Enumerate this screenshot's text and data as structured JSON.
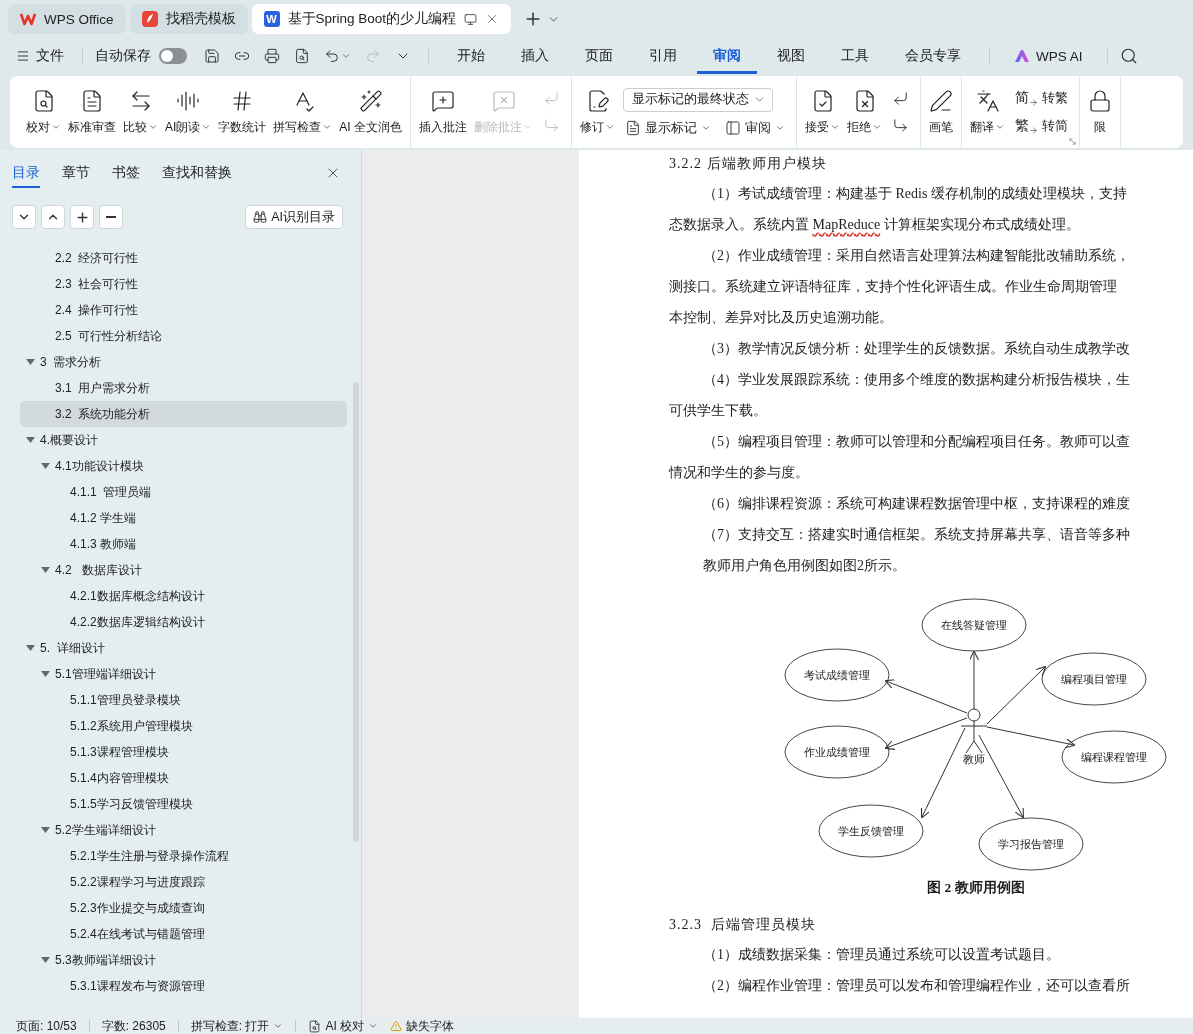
{
  "title_tabs": [
    {
      "kind": "home",
      "label": "WPS Office",
      "selected": false
    },
    {
      "kind": "template",
      "label": "找稻壳模板",
      "selected": false
    },
    {
      "kind": "document",
      "logo_letter": "W",
      "label": "基于Spring Boot的少儿编程",
      "selected": true
    }
  ],
  "menu_bar": {
    "file": "文件",
    "autosave": {
      "label": "自动保存",
      "on": false
    },
    "quick_tools": [
      {
        "dropdown": false,
        "disabled": false
      },
      {
        "dropdown": false,
        "disabled": false
      },
      {
        "dropdown": false,
        "disabled": false
      },
      {
        "dropdown": false,
        "disabled": false
      },
      {
        "dropdown": true,
        "disabled": false
      },
      {
        "dropdown": false,
        "disabled": true
      },
      {
        "dropdown": false,
        "disabled": false
      }
    ],
    "tabs": [
      {
        "label": "开始",
        "selected": false
      },
      {
        "label": "插入",
        "selected": false
      },
      {
        "label": "页面",
        "selected": false
      },
      {
        "label": "引用",
        "selected": false
      },
      {
        "label": "审阅",
        "selected": true
      },
      {
        "label": "视图",
        "selected": false
      },
      {
        "label": "工具",
        "selected": false
      },
      {
        "label": "会员专享",
        "selected": false
      }
    ],
    "ai": "WPS AI"
  },
  "ribbon": {
    "groups": [
      {
        "launcher": false,
        "items": [
          {
            "kind": "large",
            "label": "校对",
            "dropdown": true,
            "disabled": false
          },
          {
            "kind": "large",
            "label": "标准审查",
            "dropdown": false,
            "disabled": false
          },
          {
            "kind": "large",
            "label": "比较",
            "dropdown": true,
            "disabled": false
          },
          {
            "kind": "large",
            "label": "AI朗读",
            "dropdown": true,
            "disabled": false
          },
          {
            "kind": "large",
            "label": "字数统计",
            "dropdown": false,
            "disabled": false
          },
          {
            "kind": "large",
            "label": "拼写检查",
            "dropdown": true,
            "disabled": false
          },
          {
            "kind": "large",
            "label": "AI 全文润色",
            "dropdown": false,
            "disabled": false
          }
        ]
      },
      {
        "launcher": false,
        "items": [
          {
            "kind": "large",
            "label": "插入批注",
            "dropdown": false,
            "disabled": false
          },
          {
            "kind": "large",
            "label": "删除批注",
            "dropdown": true,
            "disabled": true
          },
          {
            "kind": "stack",
            "buttons": [
              {
                "disabled": true
              },
              {
                "disabled": true
              }
            ]
          }
        ]
      },
      {
        "launcher": false,
        "items": [
          {
            "kind": "large",
            "label": "修订",
            "dropdown": true,
            "disabled": false
          },
          {
            "kind": "panel",
            "select": "显示标记的最终状态",
            "buttons": [
              {
                "label": "显示标记",
                "dropdown": true
              },
              {
                "label": "审阅",
                "dropdown": true
              }
            ]
          }
        ]
      },
      {
        "launcher": false,
        "items": [
          {
            "kind": "large",
            "label": "接受",
            "dropdown": true,
            "disabled": false
          },
          {
            "kind": "large",
            "label": "拒绝",
            "dropdown": true,
            "disabled": false
          },
          {
            "kind": "stack",
            "buttons": [
              {
                "disabled": false
              },
              {
                "disabled": false
              }
            ]
          }
        ]
      },
      {
        "launcher": false,
        "items": [
          {
            "kind": "large",
            "label": "画笔",
            "dropdown": false,
            "disabled": false
          }
        ]
      },
      {
        "launcher": true,
        "items": [
          {
            "kind": "large",
            "label": "翻译",
            "dropdown": true,
            "disabled": false
          },
          {
            "kind": "stack",
            "buttons": [
              {
                "glyph": "简",
                "label": "转繁",
                "disabled": false
              },
              {
                "glyph": "繁",
                "label": "转简",
                "disabled": false
              }
            ]
          }
        ]
      },
      {
        "launcher": false,
        "items": [
          {
            "kind": "large",
            "label": "限",
            "dropdown": false,
            "disabled": false
          }
        ]
      }
    ]
  },
  "sidebar": {
    "tabs": [
      {
        "label": "目录",
        "selected": true
      },
      {
        "label": "章节",
        "selected": false
      },
      {
        "label": "书签",
        "selected": false
      },
      {
        "label": "查找和替换",
        "selected": false
      }
    ],
    "tool_button": "AI识别目录",
    "outline": [
      {
        "children": [
          {
            "label": "2.2  经济可行性",
            "selected": false
          },
          {
            "label": "2.3  社会可行性",
            "selected": false
          },
          {
            "label": "2.4  操作可行性",
            "selected": false
          },
          {
            "label": "2.5  可行性分析结论",
            "selected": false
          }
        ]
      },
      {
        "label": "3  需求分析",
        "selected": false,
        "expanded": true,
        "children": [
          {
            "label": "3.1  用户需求分析",
            "selected": false
          },
          {
            "label": "3.2  系统功能分析",
            "selected": true
          }
        ]
      },
      {
        "label": "4.概要设计",
        "selected": false,
        "expanded": true,
        "children": [
          {
            "label": "4.1功能设计模块",
            "selected": false,
            "expanded": true,
            "children": [
              {
                "label": "4.1.1  管理员端",
                "selected": false
              },
              {
                "label": "4.1.2 学生端",
                "selected": false
              },
              {
                "label": "4.1.3 教师端",
                "selected": false
              }
            ]
          },
          {
            "label": "4.2   数据库设计",
            "selected": false,
            "expanded": true,
            "children": [
              {
                "label": "4.2.1数据库概念结构设计",
                "selected": false
              },
              {
                "label": "4.2.2数据库逻辑结构设计",
                "selected": false
              }
            ]
          }
        ]
      },
      {
        "label": "5.  详细设计",
        "selected": false,
        "expanded": true,
        "children": [
          {
            "label": "5.1管理端详细设计",
            "selected": false,
            "expanded": true,
            "children": [
              {
                "label": "5.1.1管理员登录模块",
                "selected": false
              },
              {
                "label": "5.1.2系统用户管理模块",
                "selected": false
              },
              {
                "label": "5.1.3课程管理模块",
                "selected": false
              },
              {
                "label": "5.1.4内容管理模块",
                "selected": false
              },
              {
                "label": "5.1.5学习反馈管理模块",
                "selected": false
              }
            ]
          },
          {
            "label": "5.2学生端详细设计",
            "selected": false,
            "expanded": true,
            "children": [
              {
                "label": "5.2.1学生注册与登录操作流程",
                "selected": false
              },
              {
                "label": "5.2.2课程学习与进度跟踪",
                "selected": false
              },
              {
                "label": "5.2.3作业提交与成绩查询",
                "selected": false
              },
              {
                "label": "5.2.4在线考试与错题管理",
                "selected": false
              }
            ]
          },
          {
            "label": "5.3教师端详细设计",
            "selected": false,
            "expanded": true,
            "children": [
              {
                "label": "5.3.1课程发布与资源管理",
                "selected": false
              }
            ]
          }
        ]
      }
    ]
  },
  "document": {
    "blocks": [
      {
        "kind": "heading",
        "text": "3.2.2 后端教师用户模块"
      },
      {
        "kind": "line",
        "indent": true,
        "text": "（1）考试成绩管理：构建基于 Redis 缓存机制的成绩处理模块，支持"
      },
      {
        "kind": "line",
        "indent": false,
        "segments": [
          {
            "text": "态数据录入。系统内置 ",
            "misspelled": false
          },
          {
            "text": "MapReduce",
            "misspelled": true
          },
          {
            "text": " 计算框架实现分布式成绩处理。",
            "misspelled": false
          }
        ]
      },
      {
        "kind": "line",
        "indent": true,
        "text": "（2）作业成绩管理：采用自然语言处理算法构建智能批改辅助系统，"
      },
      {
        "kind": "line",
        "indent": false,
        "text": "测接口。系统建立评语特征库，支持个性化评语生成。作业生命周期管理"
      },
      {
        "kind": "line",
        "indent": false,
        "text": "本控制、差异对比及历史追溯功能。"
      },
      {
        "kind": "line",
        "indent": true,
        "text": "（3）教学情况反馈分析：处理学生的反馈数据。系统自动生成教学改"
      },
      {
        "kind": "line",
        "indent": true,
        "text": "（4）学业发展跟踪系统：使用多个维度的数据构建分析报告模块，生"
      },
      {
        "kind": "line",
        "indent": false,
        "text": "可供学生下载。"
      },
      {
        "kind": "line",
        "indent": true,
        "text": "（5）编程项目管理：教师可以管理和分配编程项目任务。教师可以查"
      },
      {
        "kind": "line",
        "indent": false,
        "text": "情况和学生的参与度。"
      },
      {
        "kind": "line",
        "indent": true,
        "text": "（6）编排课程资源：系统可构建课程数据管理中枢，支持课程的难度"
      },
      {
        "kind": "line",
        "indent": true,
        "text": "（7）支持交互：搭建实时通信框架。系统支持屏幕共享、语音等多种"
      },
      {
        "kind": "line",
        "indent": true,
        "text": "教师用户角色用例图如图2所示。"
      },
      {
        "kind": "figure",
        "actor": "教师",
        "use_cases": [
          {
            "label": "在线答疑管理"
          },
          {
            "label": "考试成绩管理"
          },
          {
            "label": "编程项目管理"
          },
          {
            "label": "作业成绩管理"
          },
          {
            "label": "编程课程管理"
          },
          {
            "label": "学生反馈管理"
          },
          {
            "label": "学习报告管理"
          }
        ],
        "caption": "图 2 教师用例图"
      },
      {
        "kind": "heading",
        "text": "3.2.3  后端管理员模块"
      },
      {
        "kind": "line",
        "indent": true,
        "text": "（1）成绩数据采集：管理员通过系统可以设置考试题目。"
      },
      {
        "kind": "line",
        "indent": true,
        "text": "（2）编程作业管理：管理员可以发布和管理编程作业，还可以查看所"
      }
    ]
  },
  "status_bar": {
    "items": [
      {
        "kind": "text",
        "label": "页面: 10/53"
      },
      {
        "kind": "text",
        "label": "字数: 26305"
      },
      {
        "kind": "dropdown",
        "label": "拼写检查: 打开"
      },
      {
        "kind": "ai",
        "label": "AI 校对"
      },
      {
        "kind": "warning",
        "label": "缺失字体"
      }
    ]
  }
}
